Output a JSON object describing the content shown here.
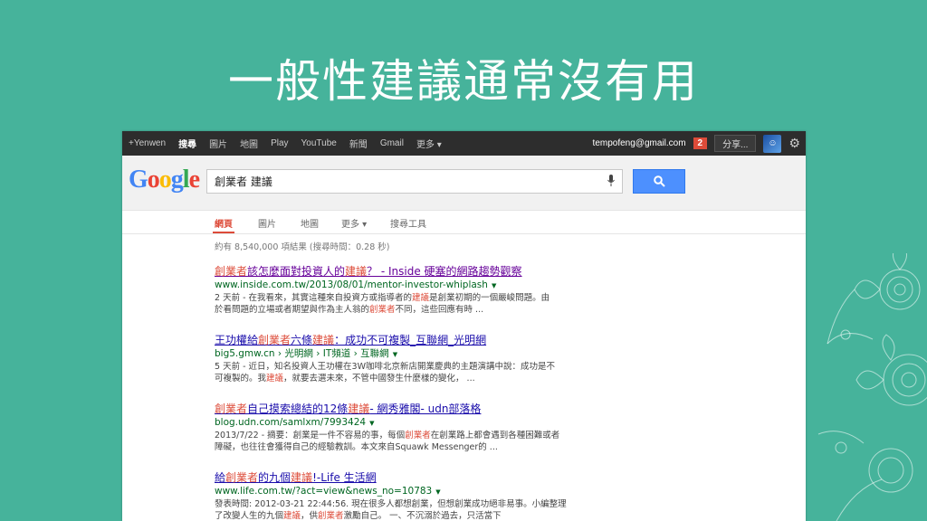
{
  "slide": {
    "title": "一般性建議通常沒有用"
  },
  "gbar": {
    "items": [
      "+Yenwen",
      "搜尋",
      "圖片",
      "地圖",
      "Play",
      "YouTube",
      "新聞",
      "Gmail",
      "更多 ▾"
    ],
    "email": "tempofeng@gmail.com",
    "notifications": "2",
    "share": "分享..."
  },
  "search": {
    "logo": "Google",
    "query": "創業者 建議"
  },
  "tabs": [
    "網頁",
    "圖片",
    "地圖",
    "更多 ▾",
    "搜尋工具"
  ],
  "stats": "約有 8,540,000 項結果 (搜尋時間：0.28 秒)",
  "results": [
    {
      "title_parts": [
        [
          "創業者",
          true
        ],
        [
          "該怎麼面對投資人的",
          false
        ],
        [
          "建議",
          true
        ],
        [
          "？ - Inside 硬塞的網路趨勢觀察",
          false
        ]
      ],
      "url": "www.inside.com.tw/2013/08/01/mentor-investor-whiplash",
      "snippet_lines": [
        [
          [
            "2 天前 - 在我看來，其實這種來自投資方或指導者的",
            false
          ],
          [
            "建議",
            true
          ],
          [
            "是創業初期的一個嚴峻問題。由",
            false
          ]
        ],
        [
          [
            "於看問題的立場或者期望與作為主人翁的",
            false
          ],
          [
            "創業者",
            true
          ],
          [
            "不同，這些回應有時 ...",
            false
          ]
        ]
      ]
    },
    {
      "title_parts": [
        [
          "王功權給",
          false
        ],
        [
          "創業者",
          true
        ],
        [
          "六條",
          false
        ],
        [
          "建議",
          true
        ],
        [
          "：成功不可複製_互聯網_光明網",
          false
        ]
      ],
      "url": "big5.gmw.cn › 光明網 › IT頻道 › 互聯網",
      "snippet_lines": [
        [
          [
            "5 天前 - 近日，知名投資人王功權在3W咖啡北京新店開業慶典的主題演講中說：成功是不",
            false
          ]
        ],
        [
          [
            "可複製的。我",
            false
          ],
          [
            "建議",
            true
          ],
          [
            "，就要去選未來，不管中國發生什麼樣的變化， ...",
            false
          ]
        ]
      ]
    },
    {
      "title_parts": [
        [
          "創業者",
          true
        ],
        [
          "自己摸索總結的12條",
          false
        ],
        [
          "建議",
          true
        ],
        [
          "- 網秀雅閣- udn部落格",
          false
        ]
      ],
      "url": "blog.udn.com/samlxm/7993424",
      "snippet_lines": [
        [
          [
            "2013/7/22 - 摘要：創業是一件不容易的事，每個",
            false
          ],
          [
            "創業者",
            true
          ],
          [
            "在創業路上都會遇到各種困難或者",
            false
          ]
        ],
        [
          [
            "障礙，也往往會獲得自己的經驗教訓。本文來自Squawk Messenger的 ...",
            false
          ]
        ]
      ]
    },
    {
      "title_parts": [
        [
          "給",
          false
        ],
        [
          "創業者",
          true
        ],
        [
          "的九個",
          false
        ],
        [
          "建議",
          true
        ],
        [
          "!-Life 生活網",
          false
        ]
      ],
      "url": "www.life.com.tw/?act=view&news_no=10783",
      "snippet_lines": [
        [
          [
            "發表時間: 2012-03-21 22:44:56. 現在很多人都想創業，但想創業成功絕非易事。小編整理",
            false
          ]
        ],
        [
          [
            "了改變人生的九個",
            false
          ],
          [
            "建議",
            true
          ],
          [
            "，供",
            false
          ],
          [
            "創業者",
            true
          ],
          [
            "激勵自己。 一、不沉溺於過去，只活當下",
            false
          ]
        ]
      ]
    }
  ],
  "colors": {
    "background": "#46b39b",
    "link": "#1a0dab",
    "highlight": "#dd4b39",
    "url": "#006621",
    "search_button": "#4d90fe"
  },
  "icons": [
    "search-icon",
    "microphone-icon",
    "gear-icon",
    "avatar",
    "floral-decoration"
  ]
}
